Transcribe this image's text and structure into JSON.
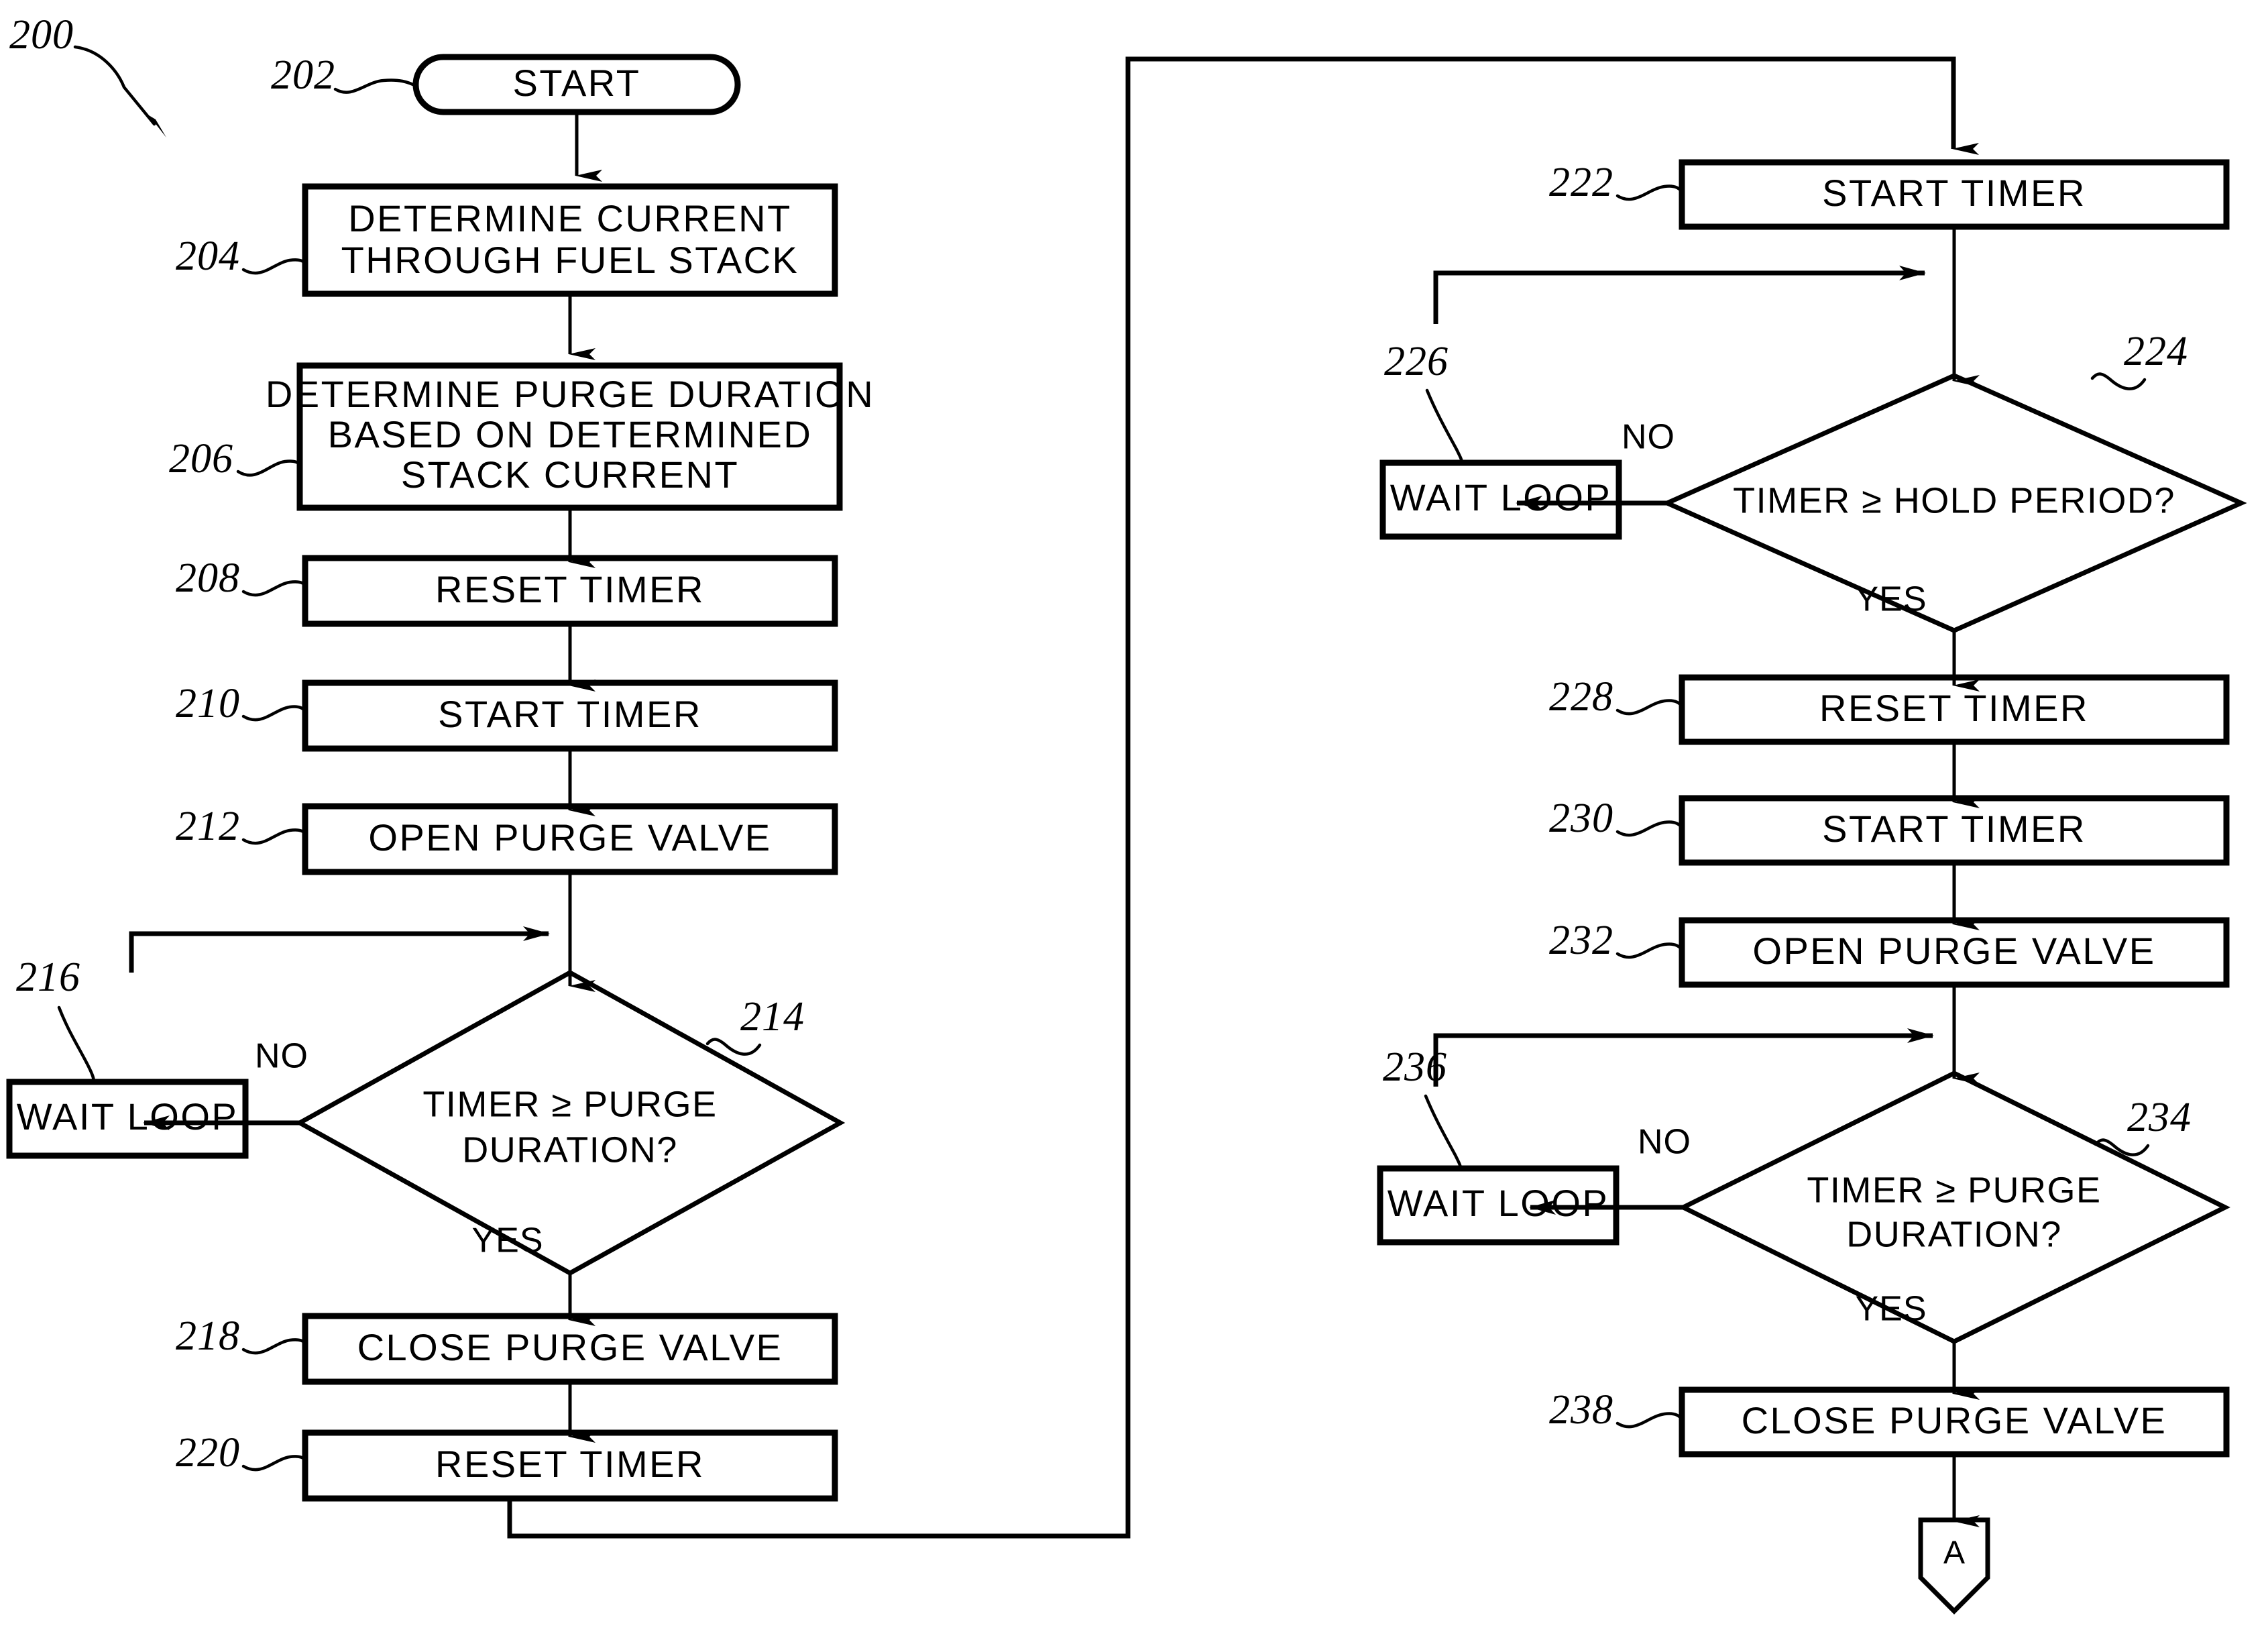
{
  "figure": {
    "reference_number": "200",
    "type": "patent-flowchart",
    "title_visible": false
  },
  "nodes": [
    {
      "id": "202",
      "ref": "202",
      "shape": "terminator",
      "lines": [
        "START"
      ]
    },
    {
      "id": "204",
      "ref": "204",
      "shape": "process",
      "lines": [
        "DETERMINE CURRENT",
        "THROUGH FUEL STACK"
      ]
    },
    {
      "id": "206",
      "ref": "206",
      "shape": "process",
      "lines": [
        "DETERMINE PURGE DURATION",
        "BASED ON DETERMINED",
        "STACK CURRENT"
      ]
    },
    {
      "id": "208",
      "ref": "208",
      "shape": "process",
      "lines": [
        "RESET TIMER"
      ]
    },
    {
      "id": "210",
      "ref": "210",
      "shape": "process",
      "lines": [
        "START TIMER"
      ]
    },
    {
      "id": "212",
      "ref": "212",
      "shape": "process",
      "lines": [
        "OPEN PURGE VALVE"
      ]
    },
    {
      "id": "214",
      "ref": "214",
      "shape": "decision",
      "lines": [
        "TIMER ≥ PURGE",
        "DURATION?"
      ]
    },
    {
      "id": "216",
      "ref": "216",
      "shape": "process",
      "lines": [
        "WAIT LOOP"
      ]
    },
    {
      "id": "218",
      "ref": "218",
      "shape": "process",
      "lines": [
        "CLOSE PURGE VALVE"
      ]
    },
    {
      "id": "220",
      "ref": "220",
      "shape": "process",
      "lines": [
        "RESET TIMER"
      ]
    },
    {
      "id": "222",
      "ref": "222",
      "shape": "process",
      "lines": [
        "START TIMER"
      ]
    },
    {
      "id": "224",
      "ref": "224",
      "shape": "decision",
      "lines": [
        "TIMER ≥ HOLD PERIOD?"
      ]
    },
    {
      "id": "226",
      "ref": "226",
      "shape": "process",
      "lines": [
        "WAIT LOOP"
      ]
    },
    {
      "id": "228",
      "ref": "228",
      "shape": "process",
      "lines": [
        "RESET TIMER"
      ]
    },
    {
      "id": "230",
      "ref": "230",
      "shape": "process",
      "lines": [
        "START TIMER"
      ]
    },
    {
      "id": "232",
      "ref": "232",
      "shape": "process",
      "lines": [
        "OPEN PURGE VALVE"
      ]
    },
    {
      "id": "234",
      "ref": "234",
      "shape": "decision",
      "lines": [
        "TIMER ≥ PURGE",
        "DURATION?"
      ]
    },
    {
      "id": "236",
      "ref": "236",
      "shape": "process",
      "lines": [
        "WAIT LOOP"
      ]
    },
    {
      "id": "238",
      "ref": "238",
      "shape": "process",
      "lines": [
        "CLOSE PURGE VALVE"
      ]
    },
    {
      "id": "A",
      "ref": "",
      "shape": "offpage-connector",
      "lines": [
        "A"
      ]
    }
  ],
  "branch_labels": {
    "d214_no": "NO",
    "d214_yes": "YES",
    "d224_no": "NO",
    "d224_yes": "YES",
    "d234_no": "NO",
    "d234_yes": "YES"
  },
  "text": {
    "start": "START",
    "determine_current_l1": "DETERMINE CURRENT",
    "determine_current_l2": "THROUGH FUEL STACK",
    "determine_purge_l1": "DETERMINE PURGE DURATION",
    "determine_purge_l2": "BASED ON DETERMINED",
    "determine_purge_l3": "STACK CURRENT",
    "reset_timer": "RESET TIMER",
    "start_timer": "START TIMER",
    "open_purge_valve": "OPEN PURGE VALVE",
    "close_purge_valve": "CLOSE PURGE VALVE",
    "wait_loop": "WAIT LOOP",
    "timer_purge_l1": "TIMER ≥ PURGE",
    "timer_purge_l2": "DURATION?",
    "timer_hold": "TIMER ≥ HOLD PERIOD?",
    "connector_a": "A",
    "yes": "YES",
    "no": "NO"
  },
  "refs": {
    "fig": "200",
    "n202": "202",
    "n204": "204",
    "n206": "206",
    "n208": "208",
    "n210": "210",
    "n212": "212",
    "n214": "214",
    "n216": "216",
    "n218": "218",
    "n220": "220",
    "n222": "222",
    "n224": "224",
    "n226": "226",
    "n228": "228",
    "n230": "230",
    "n232": "232",
    "n234": "234",
    "n236": "236",
    "n238": "238"
  },
  "colors": {
    "ink": "#000000",
    "paper": "#ffffff"
  }
}
